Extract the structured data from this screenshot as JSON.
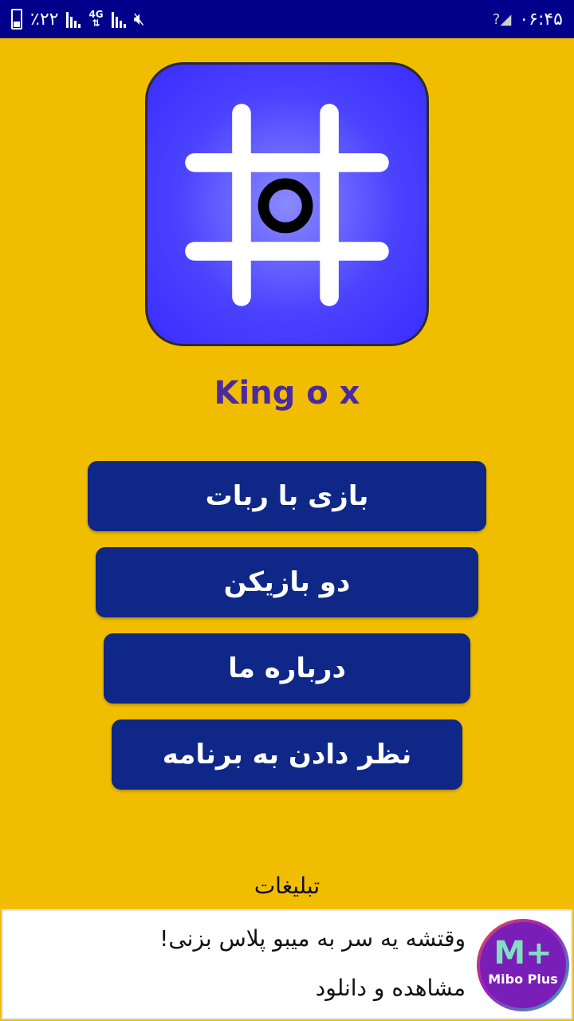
{
  "status_bar": {
    "battery_percent": "٪۲۲",
    "network_type": "4G",
    "time": "۰۶:۴۵",
    "icons": [
      "battery-icon",
      "signal-icon",
      "network-4g-icon",
      "signal-icon",
      "mute-icon",
      "no-sim-signal-icon"
    ],
    "background": "#00008b"
  },
  "app": {
    "title": "King o x",
    "title_color": "#4b2aa0",
    "logo_icon": "tic-tac-toe-icon",
    "background": "#f0bd00"
  },
  "menu": {
    "buttons": [
      {
        "label": "بازی با ربات"
      },
      {
        "label": "دو بازیکن"
      },
      {
        "label": "درباره ما"
      },
      {
        "label": "نظر دادن به برنامه"
      }
    ],
    "button_color": "#0f2787"
  },
  "ads": {
    "label": "تبلیغات",
    "line1": "وقتشه یه سر به میبو پلاس بزنی!",
    "line2": "مشاهده و دانلود",
    "logo_mark": "M+",
    "logo_text": "Mibo Plus"
  }
}
